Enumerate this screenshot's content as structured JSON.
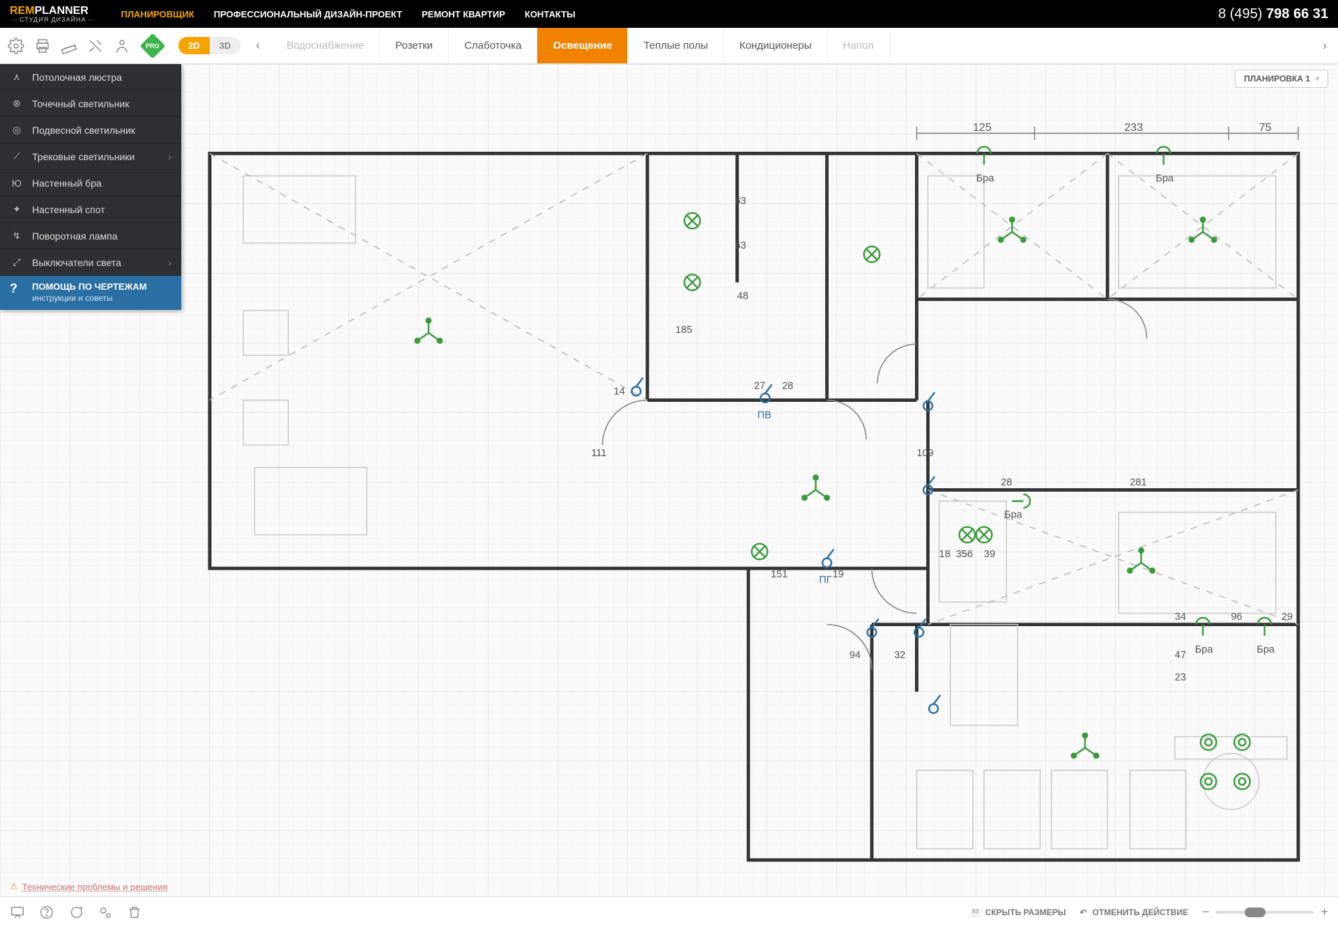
{
  "brand": {
    "rem": "REM",
    "planner": "PLANNER",
    "sub": "СТУДИЯ ДИЗАЙНА"
  },
  "nav": [
    {
      "label": "ПЛАНИРОВЩИК",
      "active": true
    },
    {
      "label": "ПРОФЕССИОНАЛЬНЫЙ ДИЗАЙН-ПРОЕКТ",
      "active": false
    },
    {
      "label": "РЕМОНТ КВАРТИР",
      "active": false
    },
    {
      "label": "КОНТАКТЫ",
      "active": false
    }
  ],
  "phone": {
    "prefix": "8 (495) ",
    "bold": "798 66 31"
  },
  "pro": "PRO",
  "viewmode": {
    "d2": "2D",
    "d3": "3D"
  },
  "plan_tabs": [
    {
      "label": "Водоснабжение",
      "state": "faded"
    },
    {
      "label": "Розетки",
      "state": "normal"
    },
    {
      "label": "Слаботочка",
      "state": "normal"
    },
    {
      "label": "Освещение",
      "state": "active"
    },
    {
      "label": "Теплые полы",
      "state": "normal"
    },
    {
      "label": "Кондиционеры",
      "state": "normal"
    },
    {
      "label": "Напол",
      "state": "trail"
    }
  ],
  "layout_selector": "ПЛАНИРОВКА 1",
  "side_tools": [
    {
      "label": "Потолочная люстра",
      "icon": "chandelier",
      "chev": false
    },
    {
      "label": "Точечный светильник",
      "icon": "spot",
      "chev": false
    },
    {
      "label": "Подвесной светильник",
      "icon": "pendant",
      "chev": false
    },
    {
      "label": "Трековые светильники",
      "icon": "track",
      "chev": true
    },
    {
      "label": "Настенный бра",
      "icon": "sconce",
      "chev": false
    },
    {
      "label": "Настенный спот",
      "icon": "wallspot",
      "chev": false
    },
    {
      "label": "Поворотная лампа",
      "icon": "swivel",
      "chev": false
    },
    {
      "label": "Выключатели света",
      "icon": "switch",
      "chev": true
    }
  ],
  "help": {
    "title": "ПОМОЩЬ ПО ЧЕРТЕЖАМ",
    "sub": "инструкции и советы",
    "mark": "?"
  },
  "plan_labels": {
    "sconce": "Бра",
    "pv": "ПВ",
    "pg": "ПГ",
    "dims": [
      "125",
      "233",
      "75",
      "63",
      "63",
      "185",
      "27",
      "28",
      "111",
      "14",
      "48",
      "109",
      "28",
      "281",
      "56",
      "18",
      "151",
      "19",
      "35",
      "39",
      "94",
      "32",
      "34",
      "96",
      "29",
      "47",
      "23",
      "80"
    ]
  },
  "problems": {
    "text": "Технические проблемы и решения"
  },
  "bottom": {
    "sizes_count": "80",
    "hide_sizes": "СКРЫТЬ РАЗМЕРЫ",
    "undo": "ОТМЕНИТЬ ДЕЙСТВИЕ"
  }
}
